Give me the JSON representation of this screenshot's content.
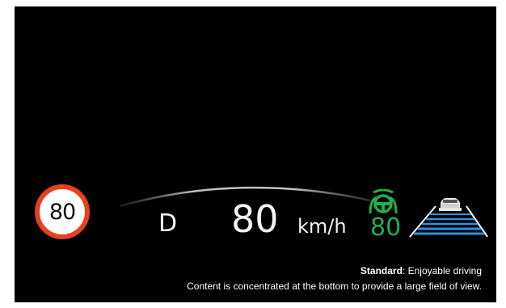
{
  "hud": {
    "speed_limit": "80",
    "gear": "D",
    "speed": "80",
    "unit": "km/h",
    "cruise_set_speed": "80"
  },
  "caption": {
    "mode_label": "Standard",
    "mode_desc": ": Enjoyable driving",
    "description": "Content is concentrated at the bottom to provide a large field of view."
  },
  "colors": {
    "background": "#000000",
    "sign_ring": "#e8401c",
    "acc_green": "#1fb04a",
    "lane_blue": "#2f8fe0"
  },
  "icons": [
    "speed-limit-sign-icon",
    "steering-assist-icon",
    "lane-car-icon"
  ]
}
